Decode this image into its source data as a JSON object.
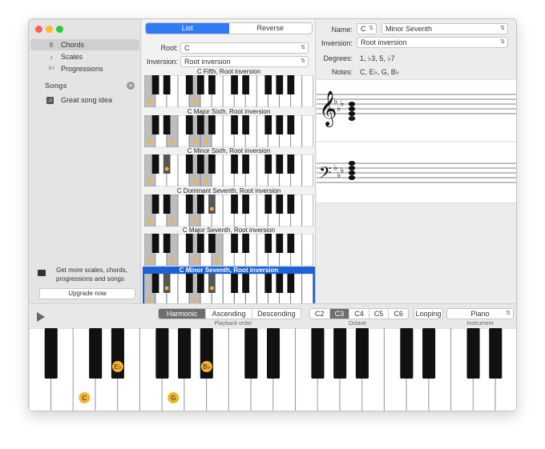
{
  "sidebar": {
    "items": [
      {
        "label": "Chords",
        "icon": "chord-icon",
        "glyph": "8"
      },
      {
        "label": "Scales",
        "icon": "scale-icon",
        "glyph": "♪"
      },
      {
        "label": "Progressions",
        "icon": "progression-icon",
        "glyph": "V-I"
      }
    ],
    "songs_header": "Songs",
    "songs": [
      {
        "label": "Great song idea",
        "icon": "music-note-icon",
        "glyph": "♫"
      }
    ],
    "promo": "Get more scales, chords, progressions and songs",
    "upgrade": "Upgrade now"
  },
  "list": {
    "tabs": [
      "List",
      "Reverse"
    ],
    "root_label": "Root:",
    "root_value": "C",
    "inversion_label": "Inversion:",
    "inversion_value": "Root inversion",
    "chords": [
      {
        "title": "C Fifth, Root inversion",
        "keys": [
          "C",
          "G"
        ]
      },
      {
        "title": "C Major Sixth, Root inversion",
        "keys": [
          "C",
          "E",
          "G",
          "A"
        ]
      },
      {
        "title": "C Minor Sixth, Root inversion",
        "keys": [
          "C",
          "E♭",
          "G",
          "A"
        ]
      },
      {
        "title": "C Dominant Seventh, Root inversion",
        "keys": [
          "C",
          "E",
          "G",
          "B♭"
        ]
      },
      {
        "title": "C Major Seventh, Root inversion",
        "keys": [
          "C",
          "E",
          "G",
          "B"
        ]
      },
      {
        "title": "C Minor Seventh, Root inversion",
        "keys": [
          "C",
          "E♭",
          "G",
          "B♭"
        ],
        "selected": true
      }
    ]
  },
  "detail": {
    "name_label": "Name:",
    "name_root": "C",
    "name_value": "Minor Seventh",
    "inversion_label": "Inversion:",
    "inversion_value": "Root inversion",
    "degrees_label": "Degrees:",
    "degrees_value": "1, ♭3, 5, ♭7",
    "notes_label": "Notes:",
    "notes_value": "C, E♭, G, B♭"
  },
  "playback": {
    "order": [
      "Harmonic",
      "Ascending",
      "Descending"
    ],
    "order_selected": "Harmonic",
    "order_caption": "Playback order",
    "octaves": [
      "C2",
      "C3",
      "C4",
      "C5",
      "C6"
    ],
    "octave_selected": "C3",
    "octave_caption": "Octave",
    "looping": "Looping",
    "instrument": "Piano",
    "instrument_caption": "Instrument"
  },
  "keyboard": {
    "highlighted": [
      {
        "note": "C",
        "label": "C"
      },
      {
        "note": "Eb",
        "label": "E♭"
      },
      {
        "note": "G",
        "label": "G"
      },
      {
        "note": "Bb",
        "label": "B♭"
      }
    ]
  },
  "colors": {
    "accent": "#2f7bf5",
    "marker": "#f5b335",
    "selected_row": "#1b62d6"
  }
}
